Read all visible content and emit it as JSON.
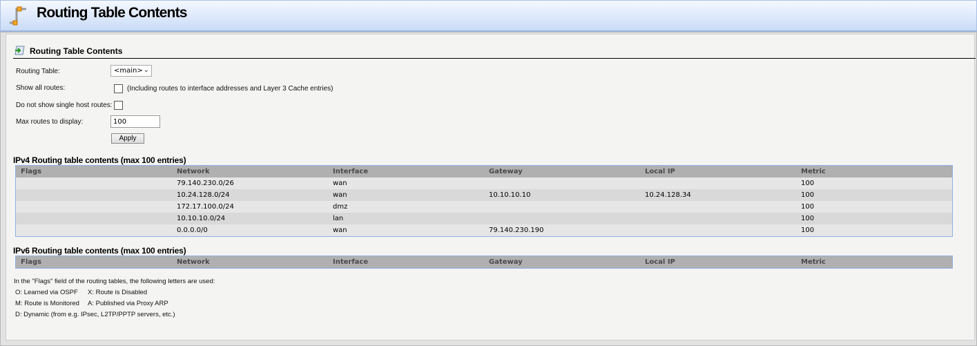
{
  "header": {
    "title": "Routing Table Contents"
  },
  "section": {
    "title": "Routing Table Contents"
  },
  "form": {
    "routing_table_label": "Routing Table:",
    "routing_table_value": "<main>",
    "show_all_label": "Show all routes:",
    "show_all_note": "(Including routes to interface addresses and Layer 3 Cache entries)",
    "no_single_host_label": "Do not show single host routes:",
    "max_routes_label": "Max routes to display:",
    "max_routes_value": "100",
    "apply_label": "Apply"
  },
  "columns": [
    "Flags",
    "Network",
    "Interface",
    "Gateway",
    "Local IP",
    "Metric"
  ],
  "ipv4": {
    "title": "IPv4 Routing table contents (max 100 entries)",
    "rows": [
      [
        "",
        "79.140.230.0/26",
        "wan",
        "",
        "",
        "100"
      ],
      [
        "",
        "10.24.128.0/24",
        "wan",
        "10.10.10.10",
        "10.24.128.34",
        "100"
      ],
      [
        "",
        "172.17.100.0/24",
        "dmz",
        "",
        "",
        "100"
      ],
      [
        "",
        "10.10.10.0/24",
        "lan",
        "",
        "",
        "100"
      ],
      [
        "",
        "0.0.0.0/0",
        "wan",
        "79.140.230.190",
        "",
        "100"
      ]
    ]
  },
  "ipv6": {
    "title": "IPv6 Routing table contents (max 100 entries)"
  },
  "legend": {
    "intro": "In the \"Flags\" field of the routing tables, the following letters are used:",
    "o": "O: Learned via OSPF",
    "x": "X: Route is Disabled",
    "m": "M: Route is Monitored",
    "a": "A: Published via Proxy ARP",
    "d": "D: Dynamic (from e.g. IPsec, L2TP/PPTP servers, etc.)"
  }
}
